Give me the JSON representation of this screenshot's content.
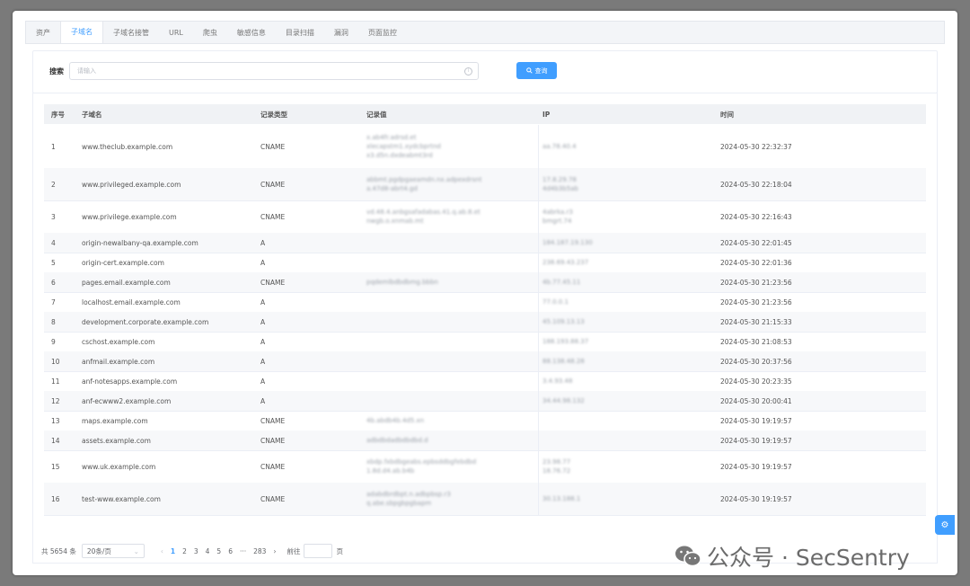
{
  "tabs": [
    "资产",
    "子域名",
    "子域名接管",
    "URL",
    "爬虫",
    "敏感信息",
    "目录扫描",
    "漏洞",
    "页面监控"
  ],
  "active_tab": 1,
  "search": {
    "label": "搜索",
    "placeholder": "请输入",
    "button": "查询"
  },
  "columns": [
    "序号",
    "子域名",
    "记录类型",
    "记录值",
    "IP",
    "时间"
  ],
  "rows": [
    {
      "no": "1",
      "domain": "www.theclub.example.com",
      "type": "CNAME",
      "value": "x.ab4fr.adrsd.et\nxlecapstm1.xydcbprtnd\nx3.d5n.dxdeabmt3rd",
      "ip": "aa.78.40.4",
      "time": "2024-05-30 22:32:37"
    },
    {
      "no": "2",
      "domain": "www.privileged.example.com",
      "type": "CNAME",
      "value": "abbmt.pgdpgaeamdn.nx.adpexdrsnt\na.47d8-abrt4.gd",
      "ip": "17.8.29.78\n4d4b3b5ab",
      "time": "2024-05-30 22:18:04"
    },
    {
      "no": "3",
      "domain": "www.privilege.example.com",
      "type": "CNAME",
      "value": "vd.48.4.anbgsafadabas.41.q.ab.8.et\nnwgb.o.xnmab.mt",
      "ip": "4abrka.r3\nbmgrt.74",
      "time": "2024-05-30 22:16:43"
    },
    {
      "no": "4",
      "domain": "origin-newalbany-qa.example.com",
      "type": "A",
      "value": "",
      "ip": "184.187.19.130",
      "time": "2024-05-30 22:01:45"
    },
    {
      "no": "5",
      "domain": "origin-cert.example.com",
      "type": "A",
      "value": "",
      "ip": "238.69.43.237",
      "time": "2024-05-30 22:01:36"
    },
    {
      "no": "6",
      "domain": "pages.email.example.com",
      "type": "CNAME",
      "value": "pqdemlbdbdbmg.bbbn",
      "ip": "4b.77.45.11",
      "time": "2024-05-30 21:23:56"
    },
    {
      "no": "7",
      "domain": "localhost.email.example.com",
      "type": "A",
      "value": "",
      "ip": "77.0.0.1",
      "time": "2024-05-30 21:23:56"
    },
    {
      "no": "8",
      "domain": "development.corporate.example.com",
      "type": "A",
      "value": "",
      "ip": "45.109.13.13",
      "time": "2024-05-30 21:15:33"
    },
    {
      "no": "9",
      "domain": "cschost.example.com",
      "type": "A",
      "value": "",
      "ip": "188.193.88.37",
      "time": "2024-05-30 21:08:53"
    },
    {
      "no": "10",
      "domain": "anfmail.example.com",
      "type": "A",
      "value": "",
      "ip": "88.138.48.28",
      "time": "2024-05-30 20:37:56"
    },
    {
      "no": "11",
      "domain": "anf-notesapps.example.com",
      "type": "A",
      "value": "",
      "ip": "3.4.93.48",
      "time": "2024-05-30 20:23:35"
    },
    {
      "no": "12",
      "domain": "anf-ecwww2.example.com",
      "type": "A",
      "value": "",
      "ip": "34.44.98.132",
      "time": "2024-05-30 20:00:41"
    },
    {
      "no": "13",
      "domain": "maps.example.com",
      "type": "CNAME",
      "value": "4b.abdb4b.4d5.xn",
      "ip": "",
      "time": "2024-05-30 19:19:57"
    },
    {
      "no": "14",
      "domain": "assets.example.com",
      "type": "CNAME",
      "value": "adbdbdadbdbdbd.d",
      "ip": "",
      "time": "2024-05-30 19:19:57"
    },
    {
      "no": "15",
      "domain": "www.uk.example.com",
      "type": "CNAME",
      "value": "xbdp.fxbdbgeabs.epbsddbgfebdbd\n1.8d.d4.ab.b4b",
      "ip": "23.98.77\n18.76.72",
      "time": "2024-05-30 19:19:57"
    },
    {
      "no": "16",
      "domain": "test-www.example.com",
      "type": "CNAME",
      "value": "adabdbrdbpt.n.adbpbsp.r3\nq.abe.sbpgbpgbapm",
      "ip": "30.13.188.1",
      "time": "2024-05-30 19:19:57"
    }
  ],
  "pagination": {
    "total": "共 5654 条",
    "page_size": "20条/页",
    "pages": [
      "1",
      "2",
      "3",
      "4",
      "5",
      "6",
      "···",
      "283"
    ],
    "goto_label": "前往",
    "goto_suffix": "页",
    "prev": "‹",
    "next": "›"
  },
  "watermark": "公众号 · SecSentry"
}
